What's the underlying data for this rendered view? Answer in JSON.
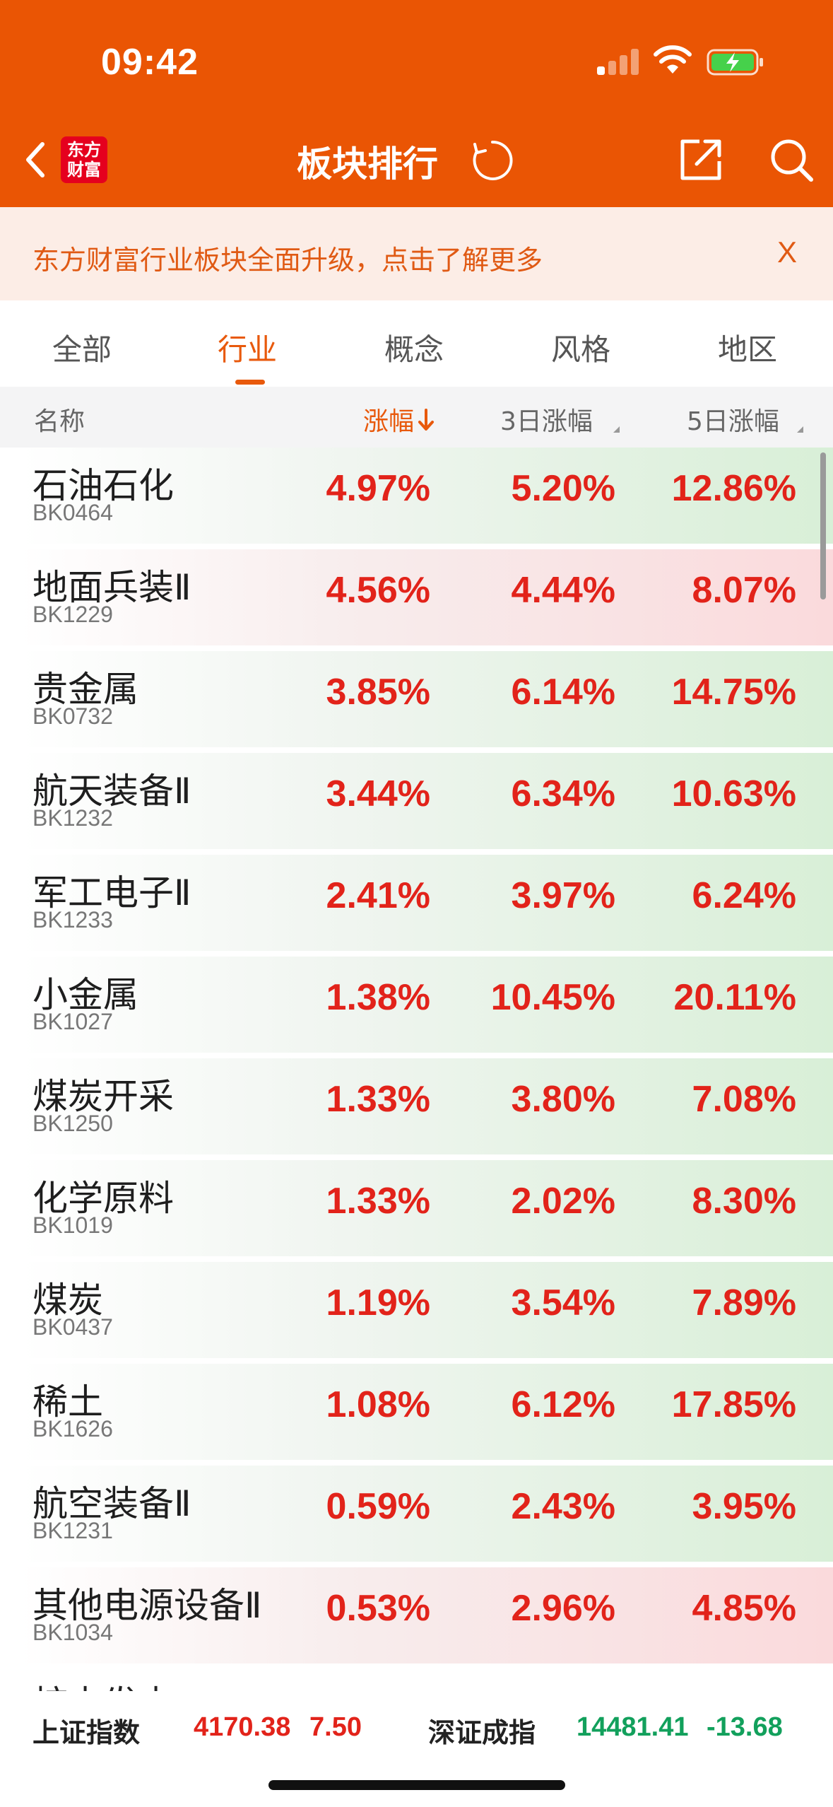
{
  "status_bar": {
    "time": "09:42"
  },
  "header": {
    "title": "板块排行",
    "logo_line1": "东方",
    "logo_line2": "财富"
  },
  "banner": {
    "text": "东方财富行业板块全面升级，点击了解更多",
    "close": "X"
  },
  "tabs": [
    {
      "label": "全部"
    },
    {
      "label": "行业"
    },
    {
      "label": "概念"
    },
    {
      "label": "风格"
    },
    {
      "label": "地区"
    }
  ],
  "active_tab": "行业",
  "columns": {
    "name": "名称",
    "change": "涨幅",
    "change_3d": "3日涨幅",
    "change_5d": "5日涨幅"
  },
  "rows": [
    {
      "name": "石油石化",
      "code": "BK0464",
      "change": "4.97%",
      "change_3d": "5.20%",
      "change_5d": "12.86%"
    },
    {
      "name": "地面兵装Ⅱ",
      "code": "BK1229",
      "change": "4.56%",
      "change_3d": "4.44%",
      "change_5d": "8.07%"
    },
    {
      "name": "贵金属",
      "code": "BK0732",
      "change": "3.85%",
      "change_3d": "6.14%",
      "change_5d": "14.75%"
    },
    {
      "name": "航天装备Ⅱ",
      "code": "BK1232",
      "change": "3.44%",
      "change_3d": "6.34%",
      "change_5d": "10.63%"
    },
    {
      "name": "军工电子Ⅱ",
      "code": "BK1233",
      "change": "2.41%",
      "change_3d": "3.97%",
      "change_5d": "6.24%"
    },
    {
      "name": "小金属",
      "code": "BK1027",
      "change": "1.38%",
      "change_3d": "10.45%",
      "change_5d": "20.11%"
    },
    {
      "name": "煤炭开采",
      "code": "BK1250",
      "change": "1.33%",
      "change_3d": "3.80%",
      "change_5d": "7.08%"
    },
    {
      "name": "化学原料",
      "code": "BK1019",
      "change": "1.33%",
      "change_3d": "2.02%",
      "change_5d": "8.30%"
    },
    {
      "name": "煤炭",
      "code": "BK0437",
      "change": "1.19%",
      "change_3d": "3.54%",
      "change_5d": "7.89%"
    },
    {
      "name": "稀土",
      "code": "BK1626",
      "change": "1.08%",
      "change_3d": "6.12%",
      "change_5d": "17.85%"
    },
    {
      "name": "航空装备Ⅱ",
      "code": "BK1231",
      "change": "0.59%",
      "change_3d": "2.43%",
      "change_5d": "3.95%"
    },
    {
      "name": "其他电源设备Ⅱ",
      "code": "BK1034",
      "change": "0.53%",
      "change_3d": "2.96%",
      "change_5d": "4.85%"
    }
  ],
  "partial_row": {
    "name": "核电发电"
  },
  "footer": {
    "idx1_label": "上证指数",
    "idx1_value": "4170.38",
    "idx1_change": "7.50",
    "idx2_label": "深证成指",
    "idx2_value": "14481.41",
    "idx2_change": "-13.68"
  },
  "colors": {
    "brand": "#EA5504",
    "up": "#E2231A",
    "down": "#12A05C",
    "accent": "#E8590C"
  }
}
